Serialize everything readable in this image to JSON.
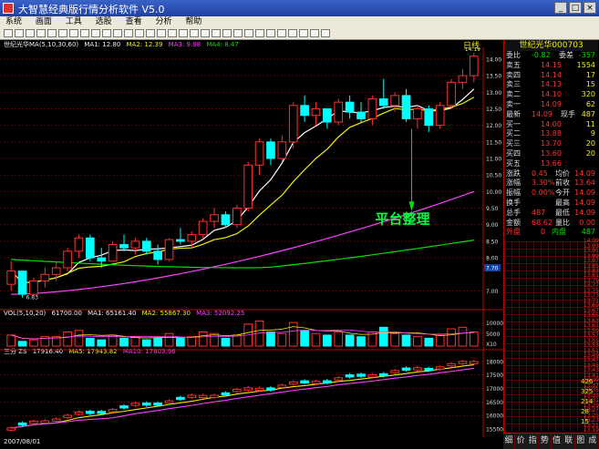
{
  "window": {
    "title": "大智慧经典版行情分析软件 V5.0"
  },
  "menu": [
    "系统",
    "画面",
    "工具",
    "选股",
    "查看",
    "分析",
    "帮助"
  ],
  "chart_header": {
    "indicator": "世纪光华MA(5,10,30,60)",
    "ma_values": [
      "MA1: 12.80",
      "MA2: 12.39",
      "MA3: 9.98",
      "MA4: 8.47"
    ],
    "period_label": "日线"
  },
  "volume_header": {
    "indicator": "VOL(5,10,20)",
    "values": [
      "61700.00",
      "MA1: 65161.40",
      "MA2: 55867.30",
      "MA3: 52092.25"
    ]
  },
  "lower_header": {
    "indicator": "三分 ZS",
    "values": [
      "17916.40",
      "MA5: 17943.82",
      "MA10: 17803.96"
    ]
  },
  "annotation": "平台整理",
  "status": {
    "date": "2007/08/01"
  },
  "price_axis": {
    "ticks": [
      "14.00",
      "13.50",
      "13.00",
      "12.50",
      "12.00",
      "11.50",
      "11.00",
      "10.50",
      "10.00",
      "9.50",
      "9.00",
      "8.50",
      "8.00",
      "7.70",
      "7.00"
    ],
    "top_label": "14.19",
    "low_label": "6.83",
    "marker": "7.70"
  },
  "volume_axis": {
    "ticks": [
      "10000",
      "5000"
    ],
    "unit": "X10"
  },
  "lower_axis": {
    "ticks": [
      "18000",
      "17500",
      "17000",
      "16500",
      "16000",
      "15500"
    ]
  },
  "quote": {
    "title": "世纪光华000703",
    "weibi": {
      "label": "委比",
      "value": "-0.82",
      "label2": "委差",
      "value2": "-357"
    },
    "asks": [
      {
        "label": "卖五",
        "price": "14.15",
        "vol": "1554"
      },
      {
        "label": "卖四",
        "price": "14.14",
        "vol": "17"
      },
      {
        "label": "卖三",
        "price": "14.13",
        "vol": "15"
      },
      {
        "label": "卖二",
        "price": "14.10",
        "vol": "320"
      },
      {
        "label": "卖一",
        "price": "14.09",
        "vol": "62"
      }
    ],
    "latest": {
      "label": "最新",
      "price": "14.09",
      "note": "现手",
      "vol": "487"
    },
    "bids": [
      {
        "label": "买一",
        "price": "14.00",
        "vol": "11"
      },
      {
        "label": "买二",
        "price": "13.88",
        "vol": "9"
      },
      {
        "label": "买三",
        "price": "13.70",
        "vol": "20"
      },
      {
        "label": "买四",
        "price": "13.60",
        "vol": "20"
      },
      {
        "label": "买五",
        "price": "13.66",
        "vol": ""
      }
    ],
    "stats": [
      {
        "l1": "涨跌",
        "v1": "0.45",
        "l2": "均价",
        "v2": "14.09"
      },
      {
        "l1": "涨幅",
        "v1": "3.30%",
        "l2": "前收",
        "v2": "13.64"
      },
      {
        "l1": "振幅",
        "v1": "0.00%",
        "l2": "今开",
        "v2": "14.09"
      },
      {
        "l1": "换手",
        "v1": "",
        "l2": "最高",
        "v2": "14.09"
      },
      {
        "l1": "总手",
        "v1": "487",
        "l2": "最低",
        "v2": "14.09"
      },
      {
        "l1": "金额",
        "v1": "68.62",
        "l2": "量比",
        "v2": "0.00"
      }
    ],
    "outer": {
      "label": "外盘",
      "value": "0",
      "label2": "内盘",
      "value2": "487"
    },
    "grid_prices": [
      "14.09",
      "13.93",
      "13.91",
      "13.89",
      "13.87",
      "13.85",
      "13.83",
      "13.81",
      "13.79",
      "13.77",
      "13.75",
      "13.73",
      "13.71",
      "13.69",
      "13.67",
      "13.65",
      "13.63",
      "13.61",
      "13.59",
      "13.57",
      "13.55",
      "13.53",
      "13.51",
      "13.49",
      "13.47",
      "13.45",
      "13.43",
      "13.41",
      "13.39",
      "13.37",
      "13.35",
      "13.33",
      "13.31",
      "13.29",
      "13.27",
      "13.25",
      "13.23",
      "13.21",
      "13.19"
    ],
    "grid_vols": [
      "426",
      "325",
      "214",
      "28",
      "15"
    ]
  },
  "tabs": [
    "细",
    "价",
    "指",
    "势",
    "值",
    "联",
    "图",
    "成"
  ],
  "colors": {
    "up": "#ff3030",
    "down": "#00ffff",
    "ma1": "#ffffff",
    "ma2": "#f0f000",
    "ma3": "#ff40ff",
    "ma4": "#00e000",
    "grid": "#8a0000"
  }
}
